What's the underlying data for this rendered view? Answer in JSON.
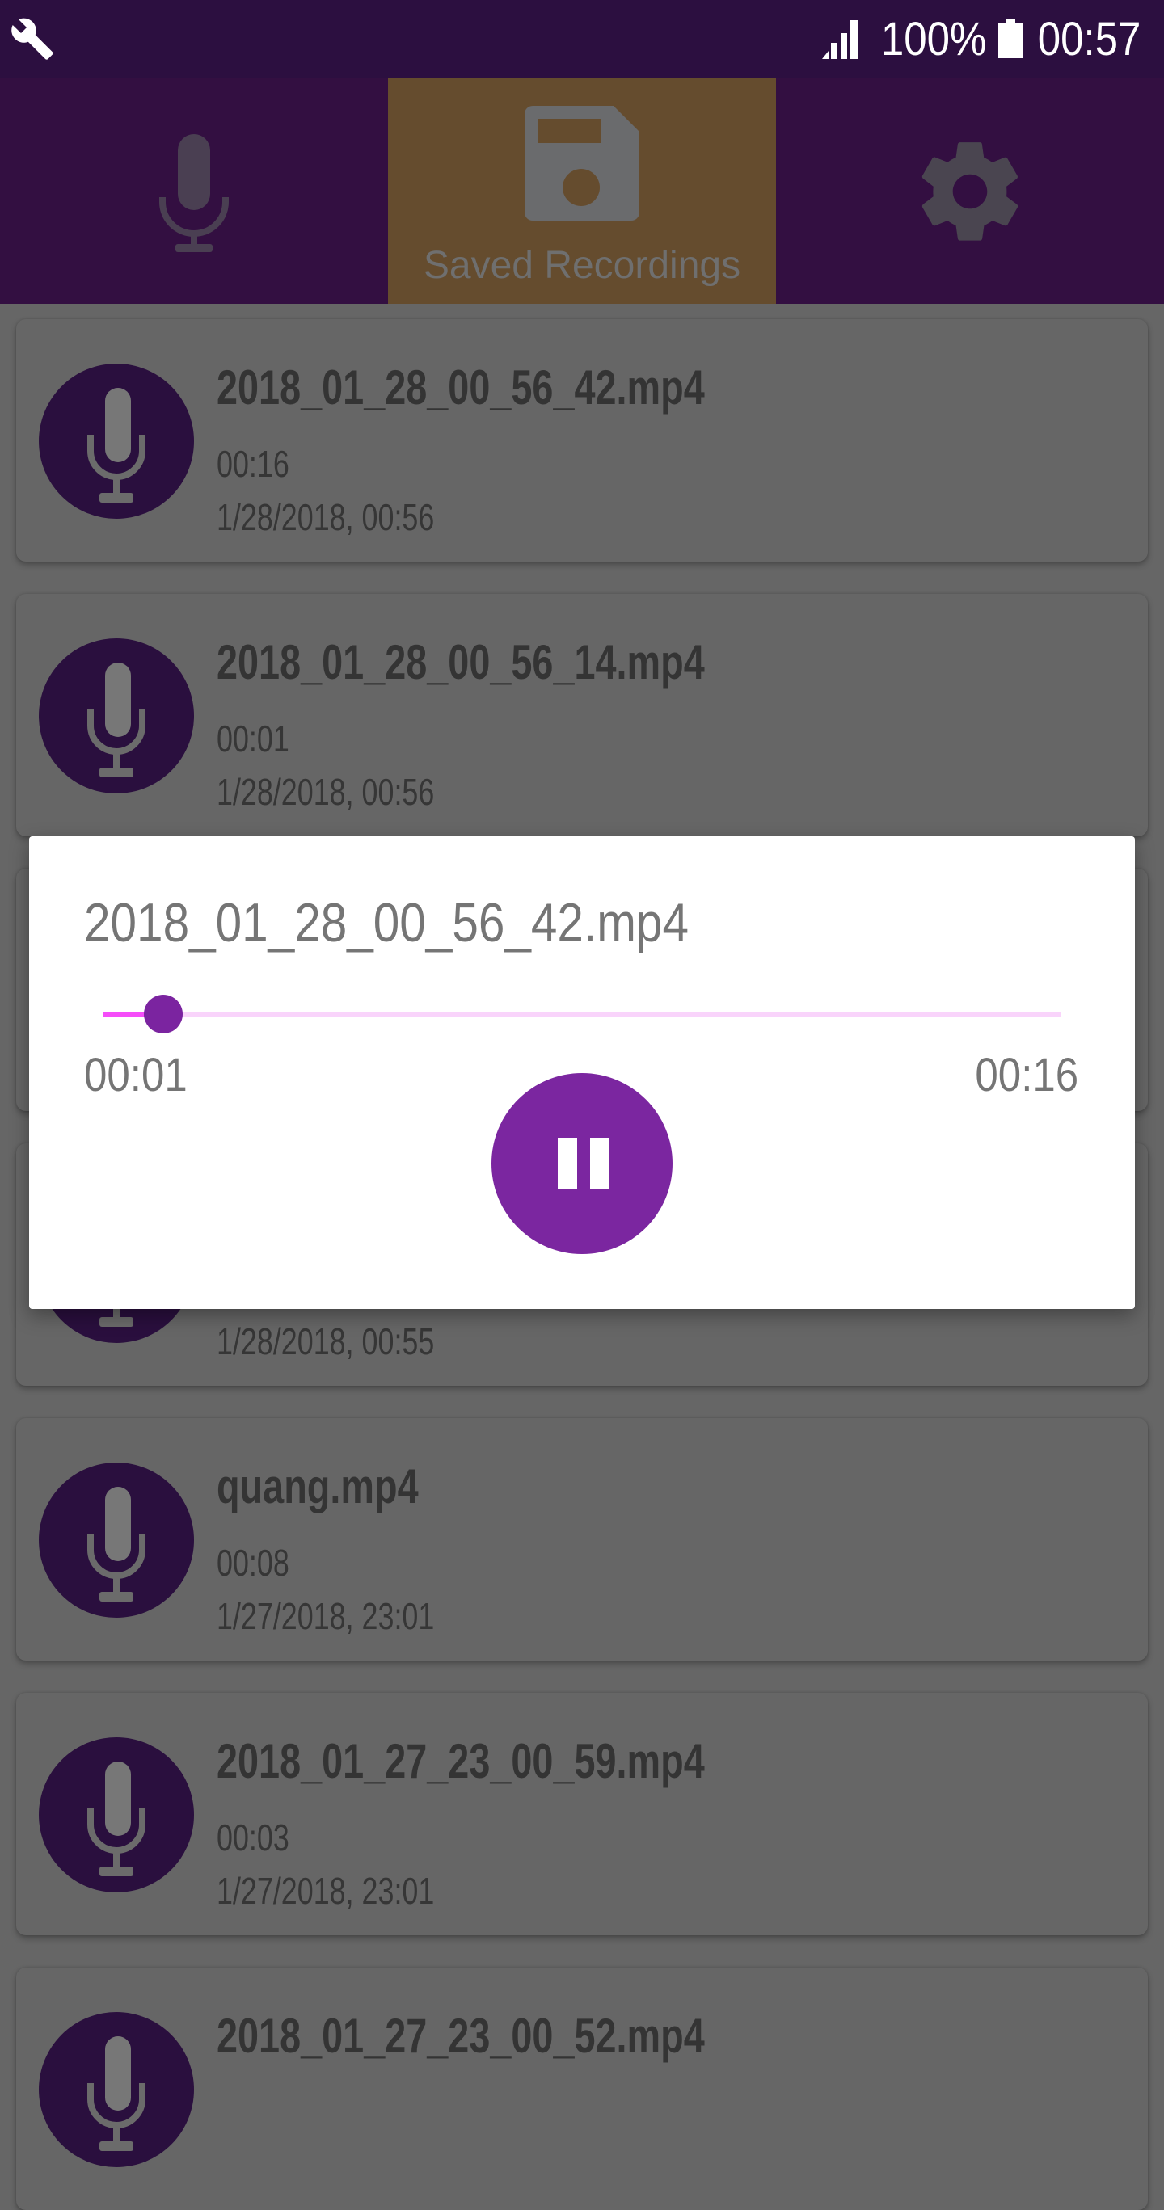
{
  "status_bar": {
    "left_icon": "wrench-icon",
    "signal_icon": "signal-icon",
    "battery_percent": "100%",
    "battery_icon": "battery-full-icon",
    "time": "00:57"
  },
  "tabs": [
    {
      "icon": "microphone-icon",
      "label": "",
      "selected": false
    },
    {
      "icon": "floppy-disk-icon",
      "label": "Saved Recordings",
      "selected": true
    },
    {
      "icon": "gear-icon",
      "label": "",
      "selected": false
    }
  ],
  "colors": {
    "status_bar": "#2c0f40",
    "tab_bar": "#330f41",
    "tab_selected": "#654c2e",
    "avatar": "#2a0f3e",
    "accent": "#7b26a0",
    "seek_active": "#f54df9",
    "seek_inactive": "#f9d4fb",
    "scrim_background": "#666666"
  },
  "recordings": [
    {
      "name": "2018_01_28_00_56_42.mp4",
      "duration": "00:16",
      "date": "1/28/2018, 00:56"
    },
    {
      "name": "2018_01_28_00_56_14.mp4",
      "duration": "00:01",
      "date": "1/28/2018, 00:56"
    },
    {
      "name": "",
      "duration": "",
      "date": ""
    },
    {
      "name": "",
      "duration": "",
      "date": "1/28/2018, 00:55"
    },
    {
      "name": "quang.mp4",
      "duration": "00:08",
      "date": "1/27/2018, 23:01"
    },
    {
      "name": "2018_01_27_23_00_59.mp4",
      "duration": "00:03",
      "date": "1/27/2018, 23:01"
    },
    {
      "name": "2018_01_27_23_00_52.mp4",
      "duration": "",
      "date": ""
    }
  ],
  "player_dialog": {
    "title": "2018_01_28_00_56_42.mp4",
    "elapsed": "00:01",
    "total": "00:16",
    "progress_fraction": 0.0625,
    "state": "playing",
    "control_icon": "pause-icon"
  }
}
